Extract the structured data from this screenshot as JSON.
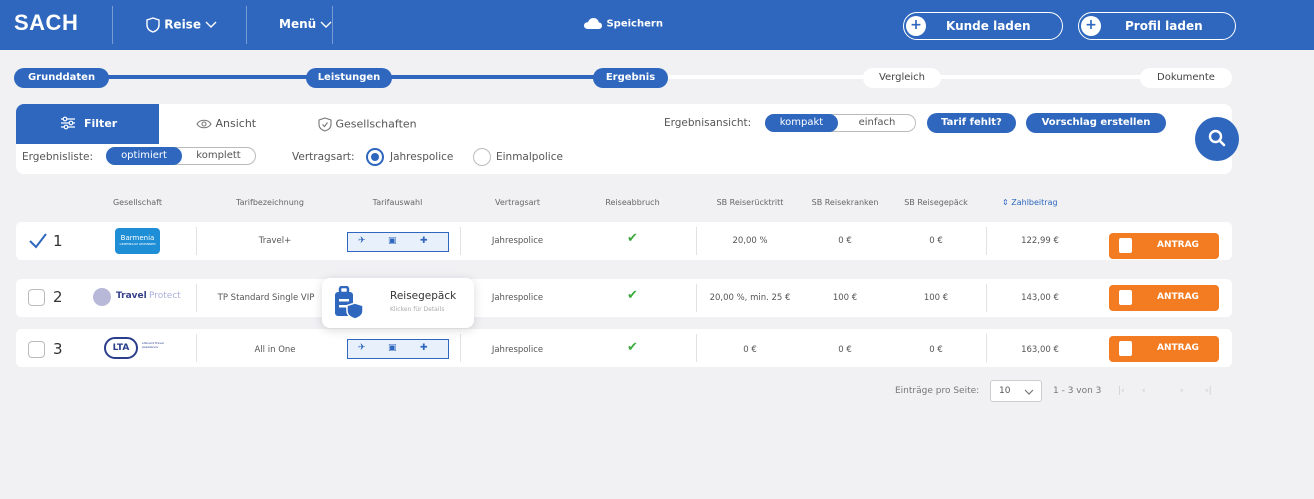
{
  "topbar": {
    "logo": "SACH",
    "reise": "Reise",
    "menu": "Menü",
    "save": "Speichern",
    "kunde": "Kunde laden",
    "profil": "Profil laden",
    "color": "#2e67bd"
  },
  "steps": [
    "Grunddaten",
    "Leistungen",
    "Ergebnis",
    "Vergleich",
    "Dokumente"
  ],
  "tabs": {
    "filter": "Filter",
    "ansicht": "Ansicht",
    "gesellschaften": "Gesellschaften"
  },
  "ergebnisansicht": {
    "label": "Ergebnisansicht:",
    "options": [
      "kompakt",
      "einfach"
    ],
    "selected": "kompakt"
  },
  "buttons": {
    "tarif_fehlt": "Tarif fehlt?",
    "vorschlag": "Vorschlag erstellen"
  },
  "ergebnisliste": {
    "label": "Ergebnisliste:",
    "options": [
      "optimiert",
      "komplett"
    ],
    "selected": "optimiert"
  },
  "vertragsart": {
    "label": "Vertragsart:",
    "options": [
      "Jahrespolice",
      "Einmalpolice"
    ],
    "selected": "Jahrespolice"
  },
  "table": {
    "headers": [
      "Gesellschaft",
      "Tarifbezeichnung",
      "Tarifauswahl",
      "Vertragsart",
      "Reiseabbruch",
      "SB Reiserücktritt",
      "SB Reisekranken",
      "SB Reisegepäck",
      "Zahlbeitrag"
    ],
    "sort_icon": "⇕",
    "rows": [
      {
        "num": "1",
        "checked": true,
        "logo": "Barmenia",
        "logo_sub": "GEMEINSAM GEWINNEN",
        "tarif": "Travel+",
        "vertragsart": "Jahrespolice",
        "abbruch": "✔",
        "sb_ruecktritt": "20,00 %",
        "sb_kranken": "0 €",
        "sb_gepaeck": "0 €",
        "beitrag": "122,99 €",
        "antrag": "ANTRAG"
      },
      {
        "num": "2",
        "checked": false,
        "logo": "Travel",
        "logo2": "Protect",
        "tarif": "TP Standard Single VIP",
        "vertragsart": "Jahrespolice",
        "abbruch": "✔",
        "sb_ruecktritt": "20,00 %, min. 25 €",
        "sb_kranken": "100 €",
        "sb_gepaeck": "100 €",
        "beitrag": "143,00 €",
        "antrag": "ANTRAG"
      },
      {
        "num": "3",
        "checked": false,
        "logo": "LTA",
        "logo_sub": "Lifecard Travel Assistance",
        "tarif": "All in One",
        "vertragsart": "Jahrespolice",
        "abbruch": "✔",
        "sb_ruecktritt": "0 €",
        "sb_kranken": "0 €",
        "sb_gepaeck": "0 €",
        "beitrag": "163,00 €",
        "antrag": "ANTRAG"
      }
    ]
  },
  "tooltip": {
    "title": "Reisegepäck",
    "sub": "Klicken für Details"
  },
  "pager": {
    "label": "Einträge pro Seite:",
    "per_page": "10",
    "range": "1 - 3 von 3",
    "first": "|‹",
    "prev": "‹",
    "next": "›",
    "last": "›|"
  }
}
